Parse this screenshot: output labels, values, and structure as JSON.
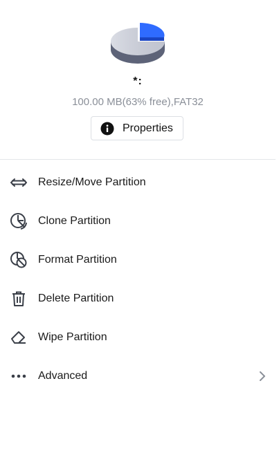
{
  "partition": {
    "drive_letter": "*:",
    "info": "100.00 MB(63% free),FAT32",
    "free_fraction": 0.63,
    "used_color": "#2f6bff",
    "free_color": "#c9ccd6"
  },
  "properties_button": {
    "label": "Properties",
    "icon": "info-icon"
  },
  "menu": {
    "items": [
      {
        "label": "Resize/Move Partition",
        "icon": "resize-arrows-icon"
      },
      {
        "label": "Clone Partition",
        "icon": "clone-icon"
      },
      {
        "label": "Format Partition",
        "icon": "format-icon"
      },
      {
        "label": "Delete Partition",
        "icon": "trash-icon"
      },
      {
        "label": "Wipe Partition",
        "icon": "eraser-icon"
      },
      {
        "label": "Advanced",
        "icon": "more-dots-icon",
        "submenu_icon": "chevron-right-icon"
      }
    ]
  }
}
